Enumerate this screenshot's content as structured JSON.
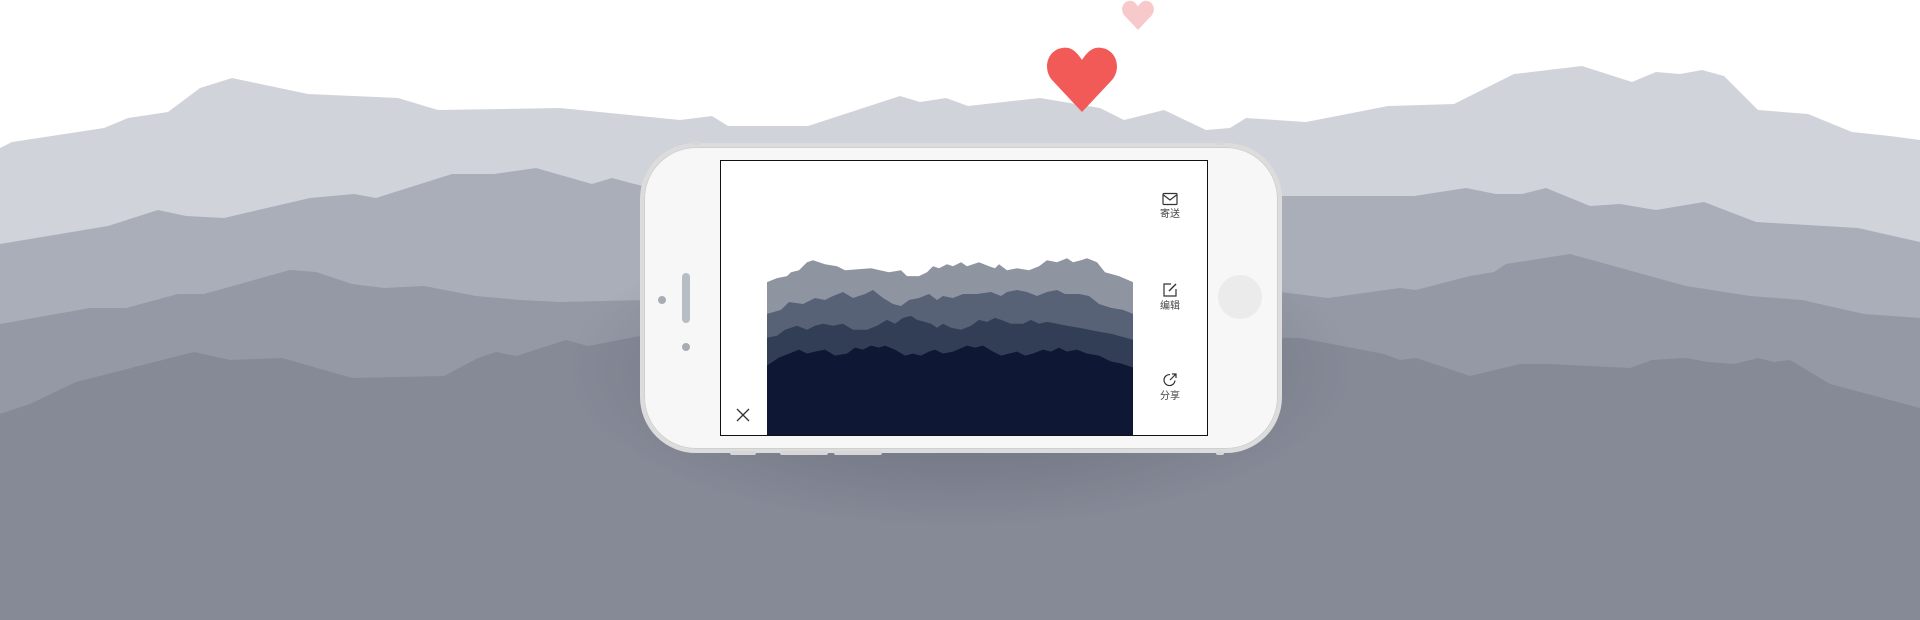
{
  "colors": {
    "ridge_1": "#d0d4da",
    "ridge_2": "#a9aeb8",
    "ridge_3": "#9499a5",
    "ridge_4": "#868a97",
    "heart_main": "#f25a57",
    "heart_faint": "#f8c9cb",
    "screen_ridge_1": "#8f94a1",
    "screen_ridge_2": "#576277",
    "screen_ridge_3": "#323e55",
    "screen_ridge_4": "#0e1733"
  },
  "icons": {
    "close": "close-icon",
    "send": "mail-icon",
    "edit": "edit-icon",
    "share": "share-icon",
    "heart": "heart-icon"
  },
  "actions": {
    "send_label": "寄送",
    "edit_label": "编辑",
    "share_label": "分享"
  }
}
